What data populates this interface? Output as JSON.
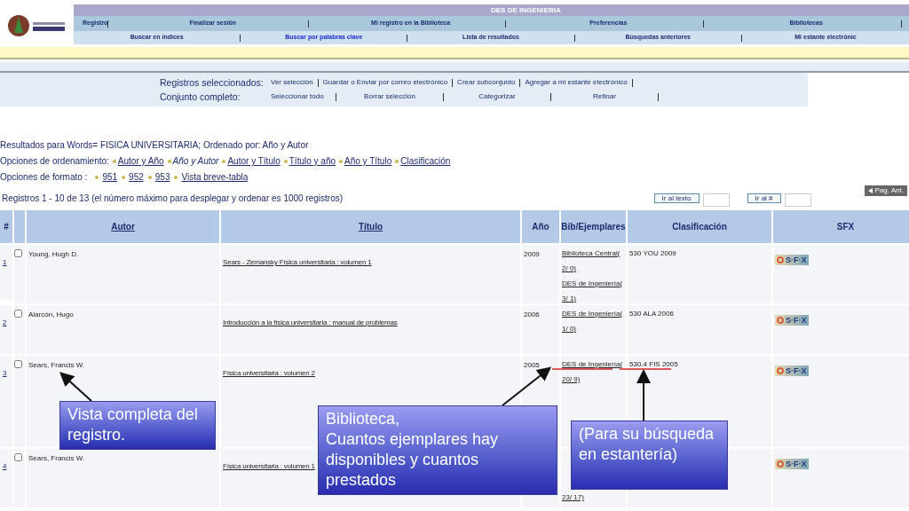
{
  "header": {
    "title": "DES DE INGENIERIA"
  },
  "nav_primary": [
    "Registro",
    "Finalizar sesión",
    "Mi registro en la Biblioteca",
    "Preferencias",
    "Bibliotecas"
  ],
  "nav_secondary": [
    {
      "label": "Buscar en índices",
      "selected": false
    },
    {
      "label": "Buscar por palabras clave",
      "selected": true
    },
    {
      "label": "Lista de resultados",
      "selected": false
    },
    {
      "label": "Búsquedas anteriores",
      "selected": false
    },
    {
      "label": "Mi estante electrónic",
      "selected": false
    }
  ],
  "selected_records": {
    "label": "Registros seleccionados:",
    "actions": [
      "Ver selección",
      "Guardar o Enviar por correo electrónico",
      "Crear subconjunto",
      "Agregar a mi estante electrónico"
    ]
  },
  "full_set": {
    "label": "Conjunto completo:",
    "actions": [
      "Seleccionar todo",
      "Borrar selección",
      "Categorizar",
      "Refinar"
    ]
  },
  "results_for": "Resultados para Words= FISICA UNIVERSITARIA; Ordenado por: Año y Autor",
  "sort_options": {
    "label": "Opciones de ordenamiento:",
    "items": [
      {
        "label": "Autor y Año",
        "selected": false
      },
      {
        "label": "Año y Autor",
        "selected": true
      },
      {
        "label": "Autor y Título",
        "selected": false
      },
      {
        "label": "Título y año",
        "selected": false
      },
      {
        "label": "Año y Título",
        "selected": false
      },
      {
        "label": "Clasificación",
        "selected": false
      }
    ]
  },
  "format_options": {
    "label": "Opciones de formato :",
    "items": [
      "951",
      "952",
      "953",
      "Vista breve-tabla"
    ]
  },
  "record_count": "Registros 1 - 10 de 13 (el número máximo para desplegar y ordenar es 1000 registros)",
  "goto_text_button": "Ir al texto",
  "goto_number_button": "Ir al #",
  "prev_page_button": "Pag. Ant.",
  "table": {
    "columns": [
      "#",
      "Autor",
      "Título",
      "Año",
      "Bib/Ejemplares",
      "Clasificación",
      "SFX"
    ],
    "rows": [
      {
        "number": "1",
        "checked": false,
        "author": "Young, Hugh D.",
        "title": "Sears - Zemansky Física universitaria : volumen 1",
        "year": "2009",
        "holdings": [
          "Biblioteca Central(",
          "2/ 0)",
          "DES de Ingeniería(",
          "3/ 1)"
        ],
        "call_number": "530 YOU 2009",
        "sfx": "S·F·X"
      },
      {
        "number": "2",
        "checked": false,
        "author": "Alarcón, Hugo",
        "title": "Introducción a la física universitaria : manual de problemas",
        "year": "2006",
        "holdings": [
          "DES de Ingeniería(",
          "1/ 0)"
        ],
        "call_number": "530 ALA 2006",
        "sfx": "S·F·X"
      },
      {
        "number": "3",
        "checked": false,
        "author": "Sears, Francis W.",
        "title": "Física universitaria : volumen 2",
        "year": "2005",
        "holdings": [
          "DES de Ingeniería(",
          "20/ 9)"
        ],
        "call_number": "530.4 FIS 2005",
        "sfx": "S·F·X"
      },
      {
        "number": "4",
        "checked": false,
        "author": "Sears, Francis W.",
        "title": "Física universitaria : volumen 1",
        "year": "",
        "holdings": [
          "23/ 17)"
        ],
        "call_number": "",
        "sfx": "S·F·X"
      }
    ]
  },
  "callouts": [
    "Vista completa del registro.",
    "Biblioteca,\nCuantos ejemplares hay disponibles y cuantos prestados",
    "(Para su búsqueda en estantería)"
  ]
}
